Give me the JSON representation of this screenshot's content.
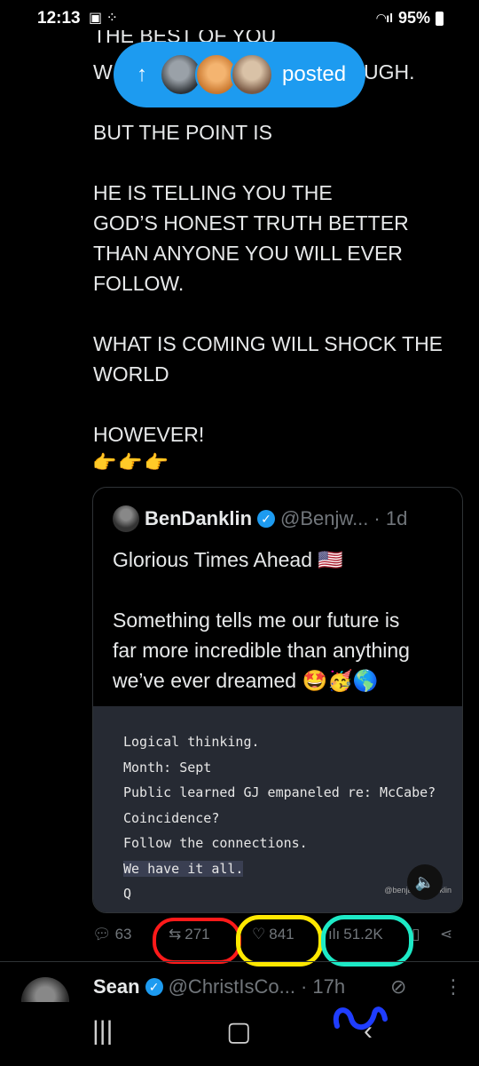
{
  "status_bar": {
    "time": "12:13",
    "battery": "95%"
  },
  "posted_pill": {
    "arrow": "↑",
    "label": "posted"
  },
  "post": {
    "partial_top": "THE BEST OF YOU",
    "line_partial_left": "W",
    "line_partial_right": "UGH.",
    "body": "BUT THE POINT IS\n\nHE IS TELLING YOU THE\nGOD’S HONEST TRUTH BETTER\nTHAN ANYONE YOU WILL EVER\nFOLLOW.\n\nWHAT IS COMING WILL SHOCK THE\nWORLD\n\nHOWEVER!",
    "emoji": "👉👉👉"
  },
  "quote": {
    "name": "BenDanklin",
    "handle": "@Benjw...",
    "time": "· 1d",
    "text": "Glorious Times Ahead 🇺🇸\n\nSomething tells me our future is\nfar more incredible than anything\nwe’ve ever dreamed 🤩🥳🌎",
    "media_lines": [
      "Logical thinking.",
      "Month: Sept",
      "Public learned GJ empaneled re: McCabe?",
      "Coincidence?",
      "Follow the connections.",
      "We have it all.",
      "Q"
    ],
    "watermark": "@benjaminDanklin"
  },
  "actions": {
    "replies": "63",
    "reposts": "271",
    "likes": "841",
    "views": "51.2K"
  },
  "next_tweet": {
    "name": "Sean",
    "handle": "@ChristIsCo...",
    "time": "· 17h"
  },
  "colors": {
    "accent": "#1d9bf0",
    "annotation_red": "#ff1a1a",
    "annotation_yellow": "#ffe800",
    "annotation_cyan": "#1de9c6",
    "annotation_blue": "#1f3dff"
  }
}
